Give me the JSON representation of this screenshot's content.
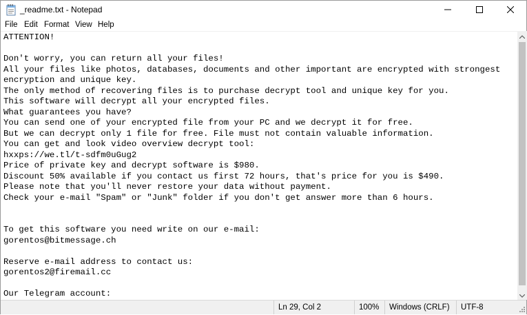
{
  "window": {
    "title": "_readme.txt - Notepad"
  },
  "menu": {
    "items": [
      {
        "label": "File"
      },
      {
        "label": "Edit"
      },
      {
        "label": "Format"
      },
      {
        "label": "View"
      },
      {
        "label": "Help"
      }
    ]
  },
  "document": {
    "text": "ATTENTION!\n\nDon't worry, you can return all your files!\nAll your files like photos, databases, documents and other important are encrypted with strongest\nencryption and unique key.\nThe only method of recovering files is to purchase decrypt tool and unique key for you.\nThis software will decrypt all your encrypted files.\nWhat guarantees you have?\nYou can send one of your encrypted file from your PC and we decrypt it for free.\nBut we can decrypt only 1 file for free. File must not contain valuable information.\nYou can get and look video overview decrypt tool:\nhxxps://we.tl/t-sdfm0uGug2\nPrice of private key and decrypt software is $980.\nDiscount 50% available if you contact us first 72 hours, that's price for you is $490.\nPlease note that you'll never restore your data without payment.\nCheck your e-mail \"Spam\" or \"Junk\" folder if you don't get answer more than 6 hours.\n\n\nTo get this software you need write on our e-mail:\ngorentos@bitmessage.ch\n\nReserve e-mail address to contact us:\ngorentos2@firemail.cc\n\nOur Telegram account:"
  },
  "status": {
    "position": "Ln 29, Col 2",
    "zoom": "100%",
    "line_endings": "Windows (CRLF)",
    "encoding": "UTF-8"
  },
  "colors": {
    "title_bg": "#ffffff",
    "statusbar_bg": "#f0f0f0",
    "scroll_thumb": "#c2c2c2"
  },
  "icons": {
    "app": "notepad-icon",
    "minimize": "minimize-icon",
    "maximize": "maximize-icon",
    "close": "close-icon"
  }
}
